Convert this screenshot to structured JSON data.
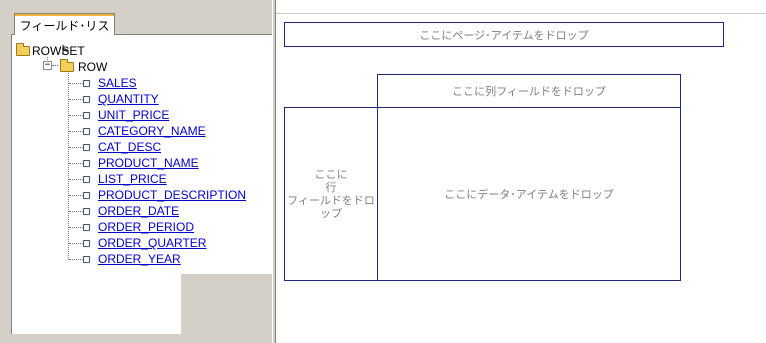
{
  "field_list": {
    "tab_label": "フィールド･リスト",
    "root": {
      "label": "ROWSET",
      "icon": "folder-open-icon"
    },
    "row": {
      "label": "ROW",
      "icon": "folder-open-icon",
      "expander": "−"
    },
    "fields": [
      "SALES",
      "QUANTITY",
      "UNIT_PRICE",
      "CATEGORY_NAME",
      "CAT_DESC",
      "PRODUCT_NAME",
      "LIST_PRICE",
      "PRODUCT_DESCRIPTION",
      "ORDER_DATE",
      "ORDER_PERIOD",
      "ORDER_QUARTER",
      "ORDER_YEAR"
    ]
  },
  "drop_zones": {
    "page": "ここにページ･アイテムをドロップ",
    "column": "ここに列フィールドをドロップ",
    "row": "ここに\n行\nフィールドをドロップ",
    "data": "ここにデータ･アイテムをドロップ"
  },
  "colors": {
    "link": "#0000cc",
    "drop_border": "#1f2a7a",
    "drop_text": "#808080",
    "panel_bg": "#d4d0c8",
    "tab_accent": "#f5b33c"
  }
}
